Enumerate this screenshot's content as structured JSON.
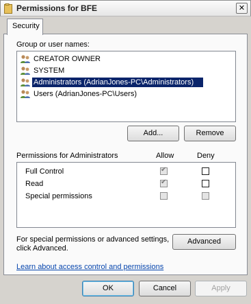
{
  "window": {
    "title": "Permissions for BFE",
    "close_glyph": "✕"
  },
  "tabs": [
    {
      "label": "Security"
    }
  ],
  "group_section": {
    "label": "Group or user names:",
    "items": [
      {
        "name": "CREATOR OWNER",
        "icon": "users-icon",
        "selected": false
      },
      {
        "name": "SYSTEM",
        "icon": "users-icon",
        "selected": false
      },
      {
        "name": "Administrators (AdrianJones-PC\\Administrators)",
        "icon": "users-icon",
        "selected": true
      },
      {
        "name": "Users (AdrianJones-PC\\Users)",
        "icon": "users-icon",
        "selected": false
      }
    ],
    "add_label": "Add...",
    "remove_label": "Remove"
  },
  "permissions_section": {
    "label": "Permissions for Administrators",
    "allow_header": "Allow",
    "deny_header": "Deny",
    "rows": [
      {
        "name": "Full Control",
        "allow": "checked-disabled",
        "deny": "unchecked"
      },
      {
        "name": "Read",
        "allow": "checked-disabled",
        "deny": "unchecked"
      },
      {
        "name": "Special permissions",
        "allow": "unchecked-disabled",
        "deny": "unchecked-disabled"
      }
    ]
  },
  "advanced": {
    "text_line1": "For special permissions or advanced settings,",
    "text_line2": "click Advanced.",
    "button_label": "Advanced"
  },
  "help_link": "Learn about access control and permissions",
  "footer": {
    "ok_label": "OK",
    "cancel_label": "Cancel",
    "apply_label": "Apply"
  },
  "colors": {
    "selection": "#0a246a",
    "link": "#0645ad",
    "dialog_bg": "#d6d3ce"
  }
}
